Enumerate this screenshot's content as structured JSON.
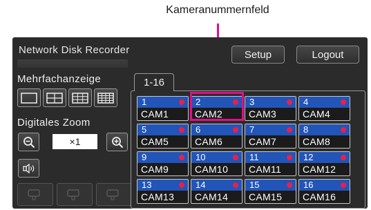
{
  "callout": {
    "label": "Kameranummernfeld"
  },
  "header": {
    "title": "Network Disk Recorder",
    "setup_label": "Setup",
    "logout_label": "Logout"
  },
  "multiscreen": {
    "title": "Mehrfachanzeige",
    "layouts": [
      "1-screen",
      "4-screen",
      "9-screen",
      "16-screen"
    ]
  },
  "zoom": {
    "title": "Digitales Zoom",
    "value": "×1"
  },
  "tab": {
    "label": "1-16"
  },
  "cameras": [
    {
      "num": "1",
      "name": "CAM1"
    },
    {
      "num": "2",
      "name": "CAM2"
    },
    {
      "num": "3",
      "name": "CAM3"
    },
    {
      "num": "4",
      "name": "CAM4"
    },
    {
      "num": "5",
      "name": "CAM5"
    },
    {
      "num": "6",
      "name": "CAM6"
    },
    {
      "num": "7",
      "name": "CAM7"
    },
    {
      "num": "8",
      "name": "CAM8"
    },
    {
      "num": "9",
      "name": "CAM9"
    },
    {
      "num": "10",
      "name": "CAM10"
    },
    {
      "num": "11",
      "name": "CAM11"
    },
    {
      "num": "12",
      "name": "CAM12"
    },
    {
      "num": "13",
      "name": "CAM13"
    },
    {
      "num": "14",
      "name": "CAM14"
    },
    {
      "num": "15",
      "name": "CAM15"
    },
    {
      "num": "16",
      "name": "CAM16"
    }
  ],
  "colors": {
    "callout": "#e0108a",
    "cam_header": "#2255b8",
    "rec_dot": "#e8204a",
    "screen_bg": "#2b2b2b"
  }
}
